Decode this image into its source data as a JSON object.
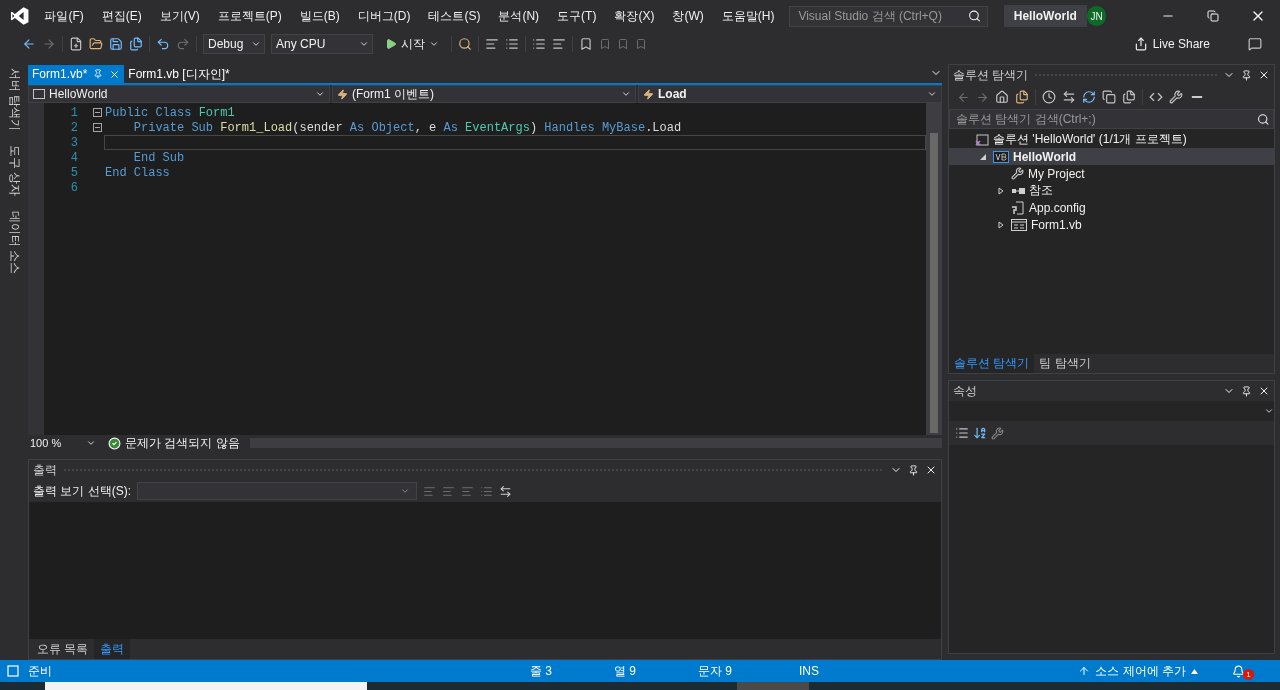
{
  "window": {
    "menu": [
      "파일(F)",
      "편집(E)",
      "보기(V)",
      "프로젝트(P)",
      "빌드(B)",
      "디버그(D)",
      "테스트(S)",
      "분석(N)",
      "도구(T)",
      "확장(X)",
      "창(W)",
      "도움말(H)"
    ],
    "search": {
      "placeholder": "Visual Studio 검색 (Ctrl+Q)"
    },
    "title": "HelloWorld",
    "avatar": "JN"
  },
  "toolbar": {
    "configuration": "Debug",
    "platform": "Any CPU",
    "start": "시작",
    "live_share": "Live Share"
  },
  "side_tabs": [
    "서버 탐색기",
    "도구 상자",
    "데이터 소스"
  ],
  "editor": {
    "tabs": [
      {
        "label": "Form1.vb*",
        "selected": true
      },
      {
        "label": "Form1.vb [디자인]*",
        "selected": false
      }
    ],
    "nav": {
      "project": "HelloWorld",
      "object": "(Form1 이벤트)",
      "member": "Load"
    },
    "lines": [
      {
        "number": "1",
        "fold": true,
        "current": false,
        "tokens": [
          {
            "text": "Public Class ",
            "kind": "keyword"
          },
          {
            "text": "Form1",
            "kind": "type"
          }
        ]
      },
      {
        "number": "2",
        "fold": true,
        "current": false,
        "tokens": [
          {
            "text": "    Private Sub ",
            "kind": "keyword"
          },
          {
            "text": "Form1_Load",
            "kind": "method"
          },
          {
            "text": "(sender ",
            "kind": "plain"
          },
          {
            "text": "As ",
            "kind": "keyword"
          },
          {
            "text": "Object",
            "kind": "keyword"
          },
          {
            "text": ", e ",
            "kind": "plain"
          },
          {
            "text": "As ",
            "kind": "keyword"
          },
          {
            "text": "EventArgs",
            "kind": "type"
          },
          {
            "text": ") ",
            "kind": "plain"
          },
          {
            "text": "Handles ",
            "kind": "keyword"
          },
          {
            "text": "MyBase",
            "kind": "keyword"
          },
          {
            "text": ".Load",
            "kind": "plain"
          }
        ]
      },
      {
        "number": "3",
        "fold": false,
        "current": true
      },
      {
        "number": "4",
        "fold": false,
        "current": false,
        "tokens": [
          {
            "text": "    End Sub",
            "kind": "keyword"
          }
        ]
      },
      {
        "number": "5",
        "fold": false,
        "current": false,
        "tokens": [
          {
            "text": "End Class",
            "kind": "keyword"
          }
        ]
      },
      {
        "number": "6",
        "fold": false,
        "current": false
      }
    ],
    "zoom": "100 %",
    "issues": "문제가 검색되지 않음"
  },
  "output": {
    "title": "출력",
    "source_label": "출력 보기 선택(S):",
    "tabs": [
      {
        "label": "오류 목록",
        "selected": false
      },
      {
        "label": "출력",
        "selected": true
      }
    ]
  },
  "solution_explorer": {
    "title": "솔루션 탐색기",
    "search": {
      "placeholder": "솔루션 탐색기 검색(Ctrl+;)"
    },
    "tree": [
      {
        "label": "솔루션 'HelloWorld' (1/1개 프로젝트)",
        "kind": "solution",
        "selected": false,
        "children": [
          {
            "label": "HelloWorld",
            "kind": "project",
            "selected": true,
            "expanded": true,
            "children": [
              {
                "label": "My Project",
                "kind": "settings",
                "selected": false
              },
              {
                "label": "참조",
                "kind": "references",
                "selected": false,
                "expanded": false
              },
              {
                "label": "App.config",
                "kind": "config",
                "selected": false
              },
              {
                "label": "Form1.vb",
                "kind": "form",
                "selected": false,
                "expanded": false
              }
            ]
          }
        ]
      }
    ],
    "tabs": [
      {
        "label": "솔루션 탐색기",
        "selected": true
      },
      {
        "label": "팀 탐색기",
        "selected": false
      }
    ]
  },
  "properties": {
    "title": "속성"
  },
  "status_bar": {
    "state": "준비",
    "line": "줄 3",
    "column": "열 9",
    "char": "문자 9",
    "mode": "INS",
    "source_control": "소스 제어에 추가",
    "notifications": "1"
  }
}
